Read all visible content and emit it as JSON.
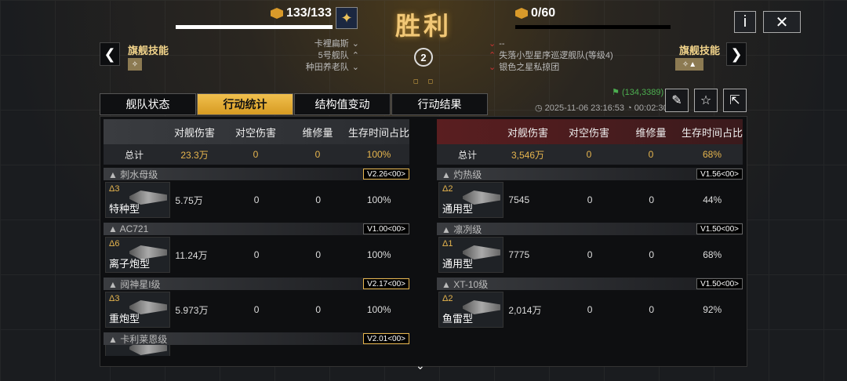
{
  "header": {
    "left_resource": "133/133",
    "right_resource": "0/60",
    "title": "胜利",
    "info_label": "i",
    "close_label": "✕",
    "left_skill": "旗舰技能",
    "right_skill": "旗舰技能",
    "left_arrow": "❮",
    "right_arrow": "❯",
    "center_number": "2",
    "left_info": [
      "卡裡扁斯",
      "5号舰队",
      "种田养老队"
    ],
    "right_info": [
      "--",
      "失落小型星序巡逻舰队(等级4)",
      "银色之星私掠团"
    ],
    "colors": {
      "accent": "#e6b54e",
      "enemy": "#b33a3a"
    }
  },
  "tabs": [
    "舰队状态",
    "行动统计",
    "结构值变动",
    "行动结果"
  ],
  "active_tab": 1,
  "coord": "(134,3389)",
  "datetime": "2025-11-06 23:16:53",
  "duration": "00:02:30",
  "columns": [
    "对舰伤害",
    "对空伤害",
    "维修量",
    "生存时间占比"
  ],
  "left": {
    "total_label": "总计",
    "total": [
      "23.3万",
      "0",
      "0",
      "100%"
    ],
    "groups": [
      {
        "cls": "刺水母级",
        "ver": "V2.26<00>",
        "gold": true,
        "lv": "Δ3",
        "type": "特种型",
        "vals": [
          "5.75万",
          "0",
          "0",
          "100%"
        ]
      },
      {
        "cls": "AC721",
        "ver": "V1.00<00>",
        "gold": false,
        "lv": "Δ6",
        "type": "离子炮型",
        "vals": [
          "11.24万",
          "0",
          "0",
          "100%"
        ]
      },
      {
        "cls": "阋神星I级",
        "ver": "V2.17<00>",
        "gold": true,
        "lv": "Δ3",
        "type": "重炮型",
        "vals": [
          "5.973万",
          "0",
          "0",
          "100%"
        ]
      },
      {
        "cls": "卡利莱恩级",
        "ver": "V2.01<00>",
        "gold": true,
        "lv": "Δ2",
        "type": "",
        "vals": [
          "",
          "",
          "",
          ""
        ]
      }
    ]
  },
  "right": {
    "total_label": "总计",
    "total": [
      "3,546万",
      "0",
      "0",
      "68%"
    ],
    "groups": [
      {
        "cls": "灼热级",
        "ver": "V1.56<00>",
        "gold": false,
        "lv": "Δ2",
        "type": "通用型",
        "vals": [
          "7545",
          "0",
          "0",
          "44%"
        ]
      },
      {
        "cls": "凛冽级",
        "ver": "V1.50<00>",
        "gold": false,
        "lv": "Δ1",
        "type": "通用型",
        "vals": [
          "7775",
          "0",
          "0",
          "68%"
        ]
      },
      {
        "cls": "XT-10级",
        "ver": "V1.50<00>",
        "gold": false,
        "lv": "Δ2",
        "type": "鱼雷型",
        "vals": [
          "2,014万",
          "0",
          "0",
          "92%"
        ]
      }
    ]
  }
}
